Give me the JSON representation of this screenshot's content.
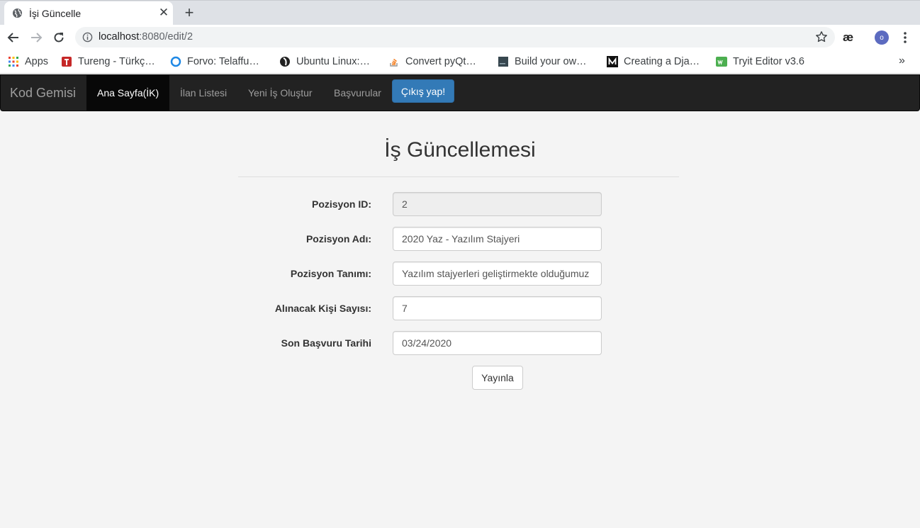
{
  "browser": {
    "tab_title": "İşi Güncelle",
    "url_host": "localhost",
    "url_path": ":8080/edit/2",
    "extension_label": "æ",
    "profile_initial": "o",
    "bookmarks": [
      {
        "label": "Apps",
        "icon": "apps-grid-icon"
      },
      {
        "label": "Tureng - Türkç…",
        "icon": "tureng-icon"
      },
      {
        "label": "Forvo: Telaffu…",
        "icon": "forvo-icon"
      },
      {
        "label": "Ubuntu Linux:…",
        "icon": "ubuntu-icon"
      },
      {
        "label": "Convert pyQt…",
        "icon": "stackoverflow-icon"
      },
      {
        "label": "Build your ow…",
        "icon": "book-icon"
      },
      {
        "label": "Creating a Dja…",
        "icon": "medium-icon"
      },
      {
        "label": "Tryit Editor v3.6",
        "icon": "w3schools-icon"
      }
    ],
    "more_bookmarks": "»"
  },
  "navbar": {
    "brand": "Kod Gemisi",
    "items": [
      {
        "label": "Ana Sayfa(İK)",
        "active": true
      },
      {
        "label": "İlan Listesi",
        "active": false
      },
      {
        "label": "Yeni İş Oluştur",
        "active": false
      },
      {
        "label": "Başvurular",
        "active": false
      }
    ],
    "logout": "Çıkış yap!"
  },
  "form": {
    "title": "İş Güncellemesi",
    "fields": [
      {
        "label": "Pozisyon ID:",
        "value": "2",
        "readonly": true
      },
      {
        "label": "Pozisyon Adı:",
        "value": "2020 Yaz - Yazılım Stajyeri",
        "readonly": false
      },
      {
        "label": "Pozisyon Tanımı:",
        "value": "Yazılım stajyerleri geliştirmekte olduğumuz",
        "readonly": false
      },
      {
        "label": "Alınacak Kişi Sayısı:",
        "value": "7",
        "readonly": false
      },
      {
        "label": "Son Başvuru Tarihi",
        "value": "03/24/2020",
        "readonly": false
      }
    ],
    "submit": "Yayınla"
  }
}
